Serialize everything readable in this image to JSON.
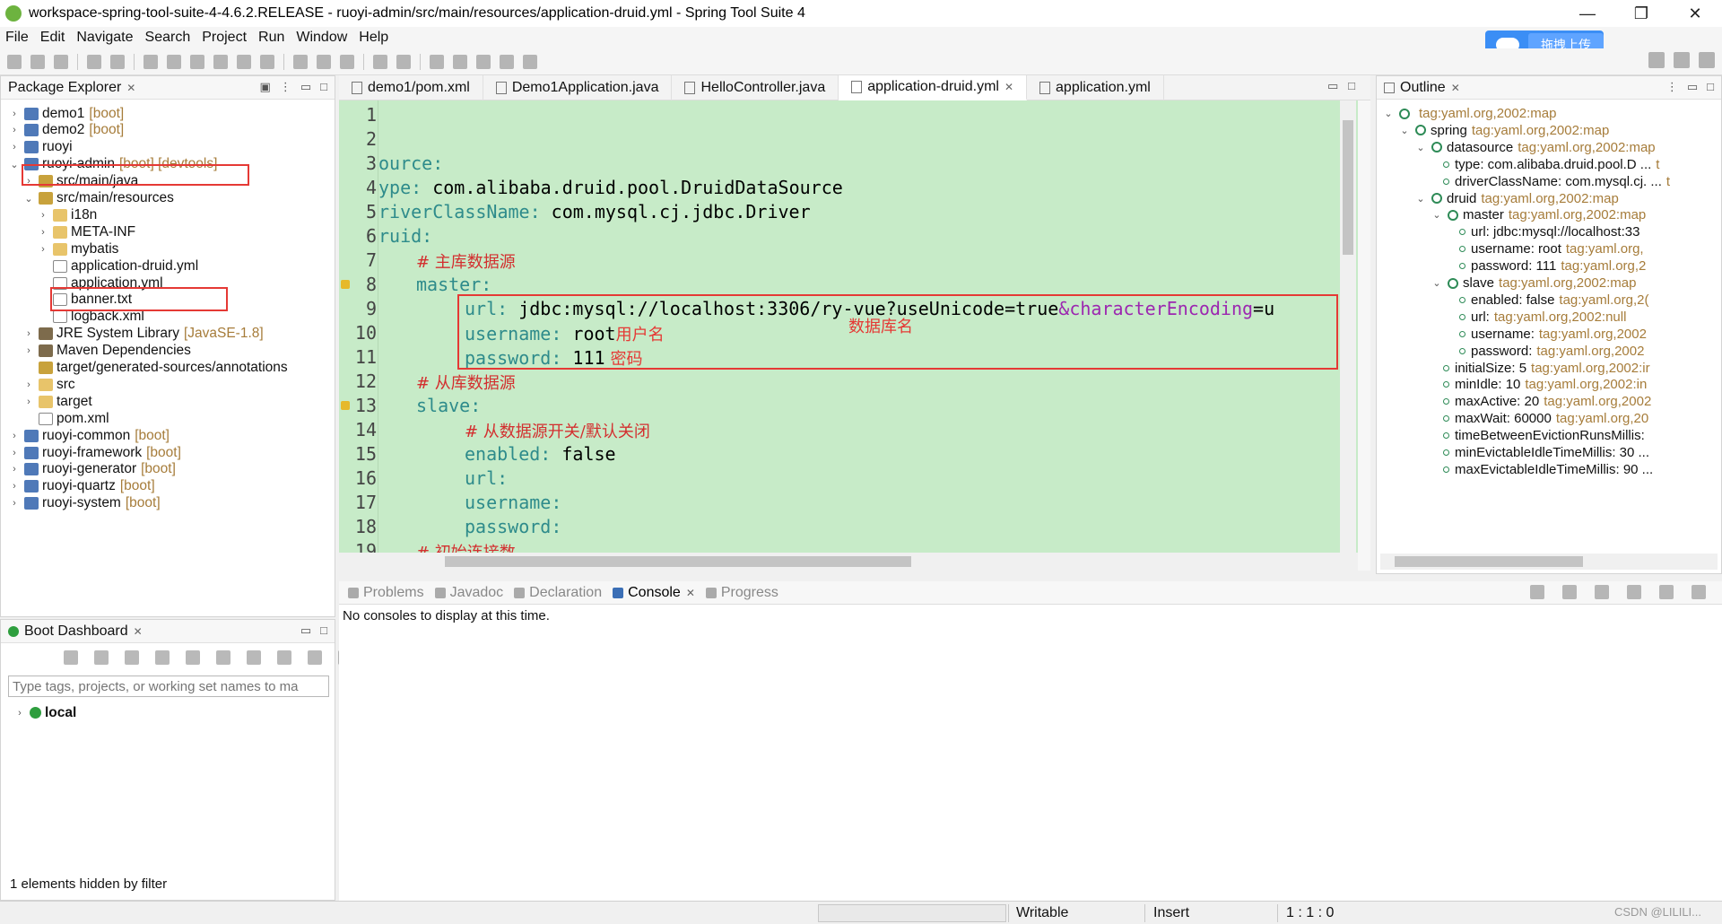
{
  "window": {
    "title": "workspace-spring-tool-suite-4-4.6.2.RELEASE - ruoyi-admin/src/main/resources/application-druid.yml - Spring Tool Suite 4",
    "minimize": "—",
    "restore": "❐",
    "close": "✕"
  },
  "menu": [
    "File",
    "Edit",
    "Navigate",
    "Search",
    "Project",
    "Run",
    "Window",
    "Help"
  ],
  "upload_button": "拖拽上传",
  "package_explorer": {
    "title": "Package Explorer",
    "items": [
      {
        "label": "demo1",
        "tag": "[boot]"
      },
      {
        "label": "demo2",
        "tag": "[boot]"
      },
      {
        "label": "ruoyi",
        "tag": ""
      },
      {
        "label": "ruoyi-admin",
        "tag": "[boot] [devtools]"
      },
      {
        "label": "src/main/java",
        "tag": ""
      },
      {
        "label": "src/main/resources",
        "tag": ""
      },
      {
        "label": "i18n",
        "tag": ""
      },
      {
        "label": "META-INF",
        "tag": ""
      },
      {
        "label": "mybatis",
        "tag": ""
      },
      {
        "label": "application-druid.yml",
        "tag": ""
      },
      {
        "label": "application.yml",
        "tag": ""
      },
      {
        "label": "banner.txt",
        "tag": ""
      },
      {
        "label": "logback.xml",
        "tag": ""
      },
      {
        "label": "JRE System Library",
        "tag": "[JavaSE-1.8]"
      },
      {
        "label": "Maven Dependencies",
        "tag": ""
      },
      {
        "label": "target/generated-sources/annotations",
        "tag": ""
      },
      {
        "label": "src",
        "tag": ""
      },
      {
        "label": "target",
        "tag": ""
      },
      {
        "label": "pom.xml",
        "tag": ""
      },
      {
        "label": "ruoyi-common",
        "tag": "[boot]"
      },
      {
        "label": "ruoyi-framework",
        "tag": "[boot]"
      },
      {
        "label": "ruoyi-generator",
        "tag": "[boot]"
      },
      {
        "label": "ruoyi-quartz",
        "tag": "[boot]"
      },
      {
        "label": "ruoyi-system",
        "tag": "[boot]"
      }
    ]
  },
  "boot_dashboard": {
    "title": "Boot Dashboard",
    "filter_placeholder": "Type tags, projects, or working set names to ma",
    "local": "local",
    "hidden_note": "1 elements hidden by filter"
  },
  "editor": {
    "tabs": [
      "demo1/pom.xml",
      "Demo1Application.java",
      "HelloController.java",
      "application-druid.yml",
      "application.yml"
    ],
    "active_tab": 3,
    "lines": [
      {
        "n": "1",
        "key": "",
        "val": ""
      },
      {
        "n": "2",
        "key": "",
        "val": ""
      },
      {
        "n": "3",
        "key": "ource:",
        "val": ""
      },
      {
        "n": "4",
        "key": "ype: ",
        "val": "com.alibaba.druid.pool.DruidDataSource"
      },
      {
        "n": "5",
        "key": "riverClassName: ",
        "val": "com.mysql.cj.jdbc.Driver"
      },
      {
        "n": "6",
        "key": "ruid:",
        "val": ""
      },
      {
        "n": "7",
        "key": "",
        "val": "# 主库数据源"
      },
      {
        "n": "8",
        "key": "master:",
        "val": ""
      },
      {
        "n": "9",
        "key": "url: ",
        "val": "jdbc:mysql://localhost:3306/ry-vue?useUnicode=true"
      },
      {
        "n": "10",
        "key": "username: ",
        "val": "root"
      },
      {
        "n": "11",
        "key": "password: ",
        "val": "111"
      },
      {
        "n": "12",
        "key": "",
        "val": "# 从库数据源"
      },
      {
        "n": "13",
        "key": "slave:",
        "val": ""
      },
      {
        "n": "14",
        "key": "",
        "val": "# 从数据源开关/默认关闭"
      },
      {
        "n": "15",
        "key": "enabled: ",
        "val": "false"
      },
      {
        "n": "16",
        "key": "url:",
        "val": ""
      },
      {
        "n": "17",
        "key": "username:",
        "val": ""
      },
      {
        "n": "18",
        "key": "password:",
        "val": ""
      },
      {
        "n": "19",
        "key": "",
        "val": "# 初始连接数"
      }
    ],
    "url_param": "&characterEncoding",
    "url_tail": "=u",
    "note_db": "数据库名",
    "note_user": "用户名",
    "note_pwd": "密码"
  },
  "outline": {
    "title": "Outline",
    "items": [
      {
        "label": "",
        "tag": "tag:yaml.org,2002:map"
      },
      {
        "label": "spring",
        "tag": "tag:yaml.org,2002:map"
      },
      {
        "label": "datasource",
        "tag": "tag:yaml.org,2002:map"
      },
      {
        "label": "type: com.alibaba.druid.pool.D ...",
        "tag": "t"
      },
      {
        "label": "driverClassName: com.mysql.cj. ...",
        "tag": "t"
      },
      {
        "label": "druid",
        "tag": "tag:yaml.org,2002:map"
      },
      {
        "label": "master",
        "tag": "tag:yaml.org,2002:map"
      },
      {
        "label": "url: jdbc:mysql://localhost:33",
        "tag": ""
      },
      {
        "label": "username: root",
        "tag": "tag:yaml.org,"
      },
      {
        "label": "password: 111",
        "tag": "tag:yaml.org,2"
      },
      {
        "label": "slave",
        "tag": "tag:yaml.org,2002:map"
      },
      {
        "label": "enabled: false",
        "tag": "tag:yaml.org,2("
      },
      {
        "label": "url:",
        "tag": "tag:yaml.org,2002:null"
      },
      {
        "label": "username:",
        "tag": "tag:yaml.org,2002"
      },
      {
        "label": "password:",
        "tag": "tag:yaml.org,2002"
      },
      {
        "label": "initialSize: 5",
        "tag": "tag:yaml.org,2002:ir"
      },
      {
        "label": "minIdle: 10",
        "tag": "tag:yaml.org,2002:in"
      },
      {
        "label": "maxActive: 20",
        "tag": "tag:yaml.org,2002"
      },
      {
        "label": "maxWait: 60000",
        "tag": "tag:yaml.org,20"
      },
      {
        "label": "timeBetweenEvictionRunsMillis:",
        "tag": ""
      },
      {
        "label": "minEvictableIdleTimeMillis: 30 ...",
        "tag": ""
      },
      {
        "label": "maxEvictableIdleTimeMillis: 90 ...",
        "tag": ""
      }
    ]
  },
  "console": {
    "tabs": [
      "Problems",
      "Javadoc",
      "Declaration",
      "Console",
      "Progress"
    ],
    "active_tab": 3,
    "message": "No consoles to display at this time."
  },
  "status": {
    "writable": "Writable",
    "insert": "Insert",
    "position": "1 : 1 : 0",
    "watermark": "CSDN @LILILI..."
  },
  "colors": {
    "editor_bg": "#c7ebc8",
    "highlight_box": "#e53935",
    "yaml_key": "#2e8b8b",
    "comment": "#d32f2f"
  }
}
